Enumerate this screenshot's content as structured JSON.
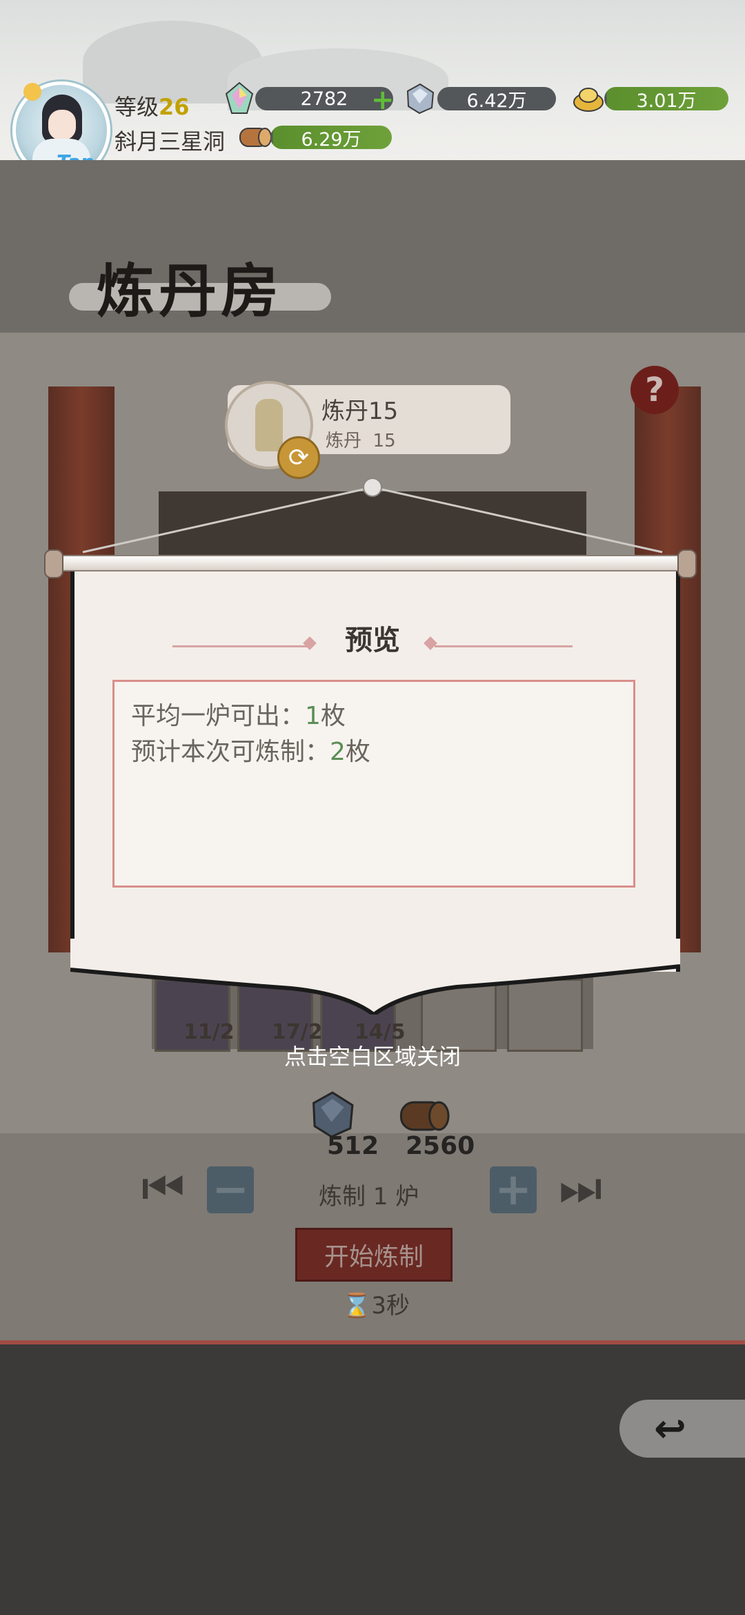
{
  "header": {
    "level_label": "等级",
    "level_value": "26",
    "cave_name": "斜月三星洞",
    "avatar_badge": "Tap",
    "resources": [
      {
        "icon": "rainbow-crystal-icon",
        "value": "2782",
        "has_plus": true
      },
      {
        "icon": "spirit-stone-icon",
        "value": "6.42万"
      },
      {
        "icon": "gold-ingot-icon",
        "value": "3.01万"
      },
      {
        "icon": "wood-log-icon",
        "value": "6.29万"
      }
    ]
  },
  "room": {
    "title": "炼丹房",
    "disciple_name": "炼丹15",
    "disciple_skill_label": "炼丹",
    "disciple_skill_value": "15",
    "help_symbol": "?"
  },
  "modal": {
    "title": "预览",
    "line1_prefix": "平均一炉可出：",
    "line1_value": "1",
    "line1_unit": "枚",
    "line2_prefix": "预计本次可炼制：",
    "line2_value": "2",
    "line2_unit": "枚",
    "close_hint": "点击空白区域关闭"
  },
  "ingredients": [
    {
      "label": "11/2"
    },
    {
      "label": "17/2"
    },
    {
      "label": "14/5"
    }
  ],
  "cost": [
    {
      "icon": "spirit-stone-icon",
      "value": "512"
    },
    {
      "icon": "wood-log-icon",
      "value": "2560"
    }
  ],
  "controls": {
    "batch_label": "炼制 1 炉",
    "start_label": "开始炼制",
    "time_label": "3秒"
  },
  "colors": {
    "accent_green": "#5a8e55",
    "level_gold": "#c2a100",
    "frame_red": "#d98f8b",
    "button_red": "#6a2823"
  }
}
